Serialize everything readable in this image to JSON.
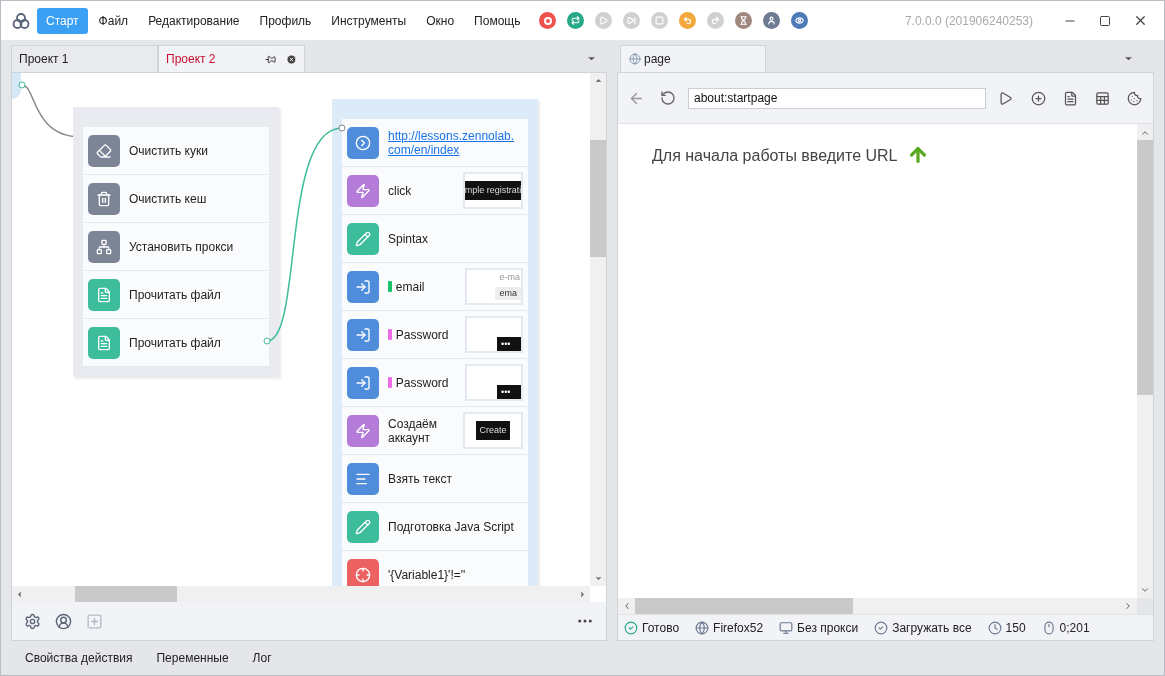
{
  "app": {
    "version": "7.0.0.0 (201906240253)"
  },
  "menu": [
    {
      "label": "Старт",
      "selected": true
    },
    {
      "label": "Файл",
      "selected": false
    },
    {
      "label": "Редактирование",
      "selected": false
    },
    {
      "label": "Профиль",
      "selected": false
    },
    {
      "label": "Инструменты",
      "selected": false
    },
    {
      "label": "Окно",
      "selected": false
    },
    {
      "label": "Помощь",
      "selected": false
    }
  ],
  "toolbar": [
    {
      "kind": "record",
      "disabled": false
    },
    {
      "kind": "loop",
      "disabled": false
    },
    {
      "kind": "play",
      "disabled": true
    },
    {
      "kind": "step",
      "disabled": true
    },
    {
      "kind": "stop",
      "disabled": true
    },
    {
      "kind": "undo",
      "disabled": false
    },
    {
      "kind": "redo",
      "disabled": true
    },
    {
      "kind": "hourglass",
      "disabled": false
    },
    {
      "kind": "user",
      "disabled": false
    },
    {
      "kind": "eye",
      "disabled": false
    }
  ],
  "project_tabs": [
    {
      "label": "Проект 1",
      "selected": false
    },
    {
      "label": "Проект 2",
      "selected": true
    }
  ],
  "canvas": {
    "groups": [
      {
        "items": [
          {
            "label": "Очистить куки",
            "kind": "cookies"
          },
          {
            "label": "Очистить кеш",
            "kind": "cache"
          },
          {
            "label": "Установить прокси",
            "kind": "proxy"
          },
          {
            "label": "Прочитать файл",
            "kind": "file"
          },
          {
            "label": "Прочитать файл",
            "kind": "file"
          }
        ]
      },
      {
        "items": [
          {
            "label": "http://lessons.zennolab.com/en/index",
            "kind": "navigate",
            "link": true
          },
          {
            "label": "click",
            "kind": "click",
            "thumbnail": {
              "kind": "button",
              "text": "mple registrati"
            }
          },
          {
            "label": "Spintax",
            "kind": "edit"
          },
          {
            "label": "email",
            "kind": "input",
            "color": "#19c26b",
            "thumbnail": {
              "kind": "field",
              "label": "e-ma",
              "value": "ema"
            }
          },
          {
            "label": "Password",
            "kind": "input",
            "color": "#ee6ae8",
            "thumbnail": {
              "kind": "password",
              "value": "•••"
            }
          },
          {
            "label": "Password",
            "kind": "input",
            "color": "#ee6ae8",
            "thumbnail": {
              "kind": "password",
              "value": "•••"
            }
          },
          {
            "label": "Создаём аккаунт",
            "kind": "click",
            "thumbnail": {
              "kind": "button",
              "text": "Create"
            }
          },
          {
            "label": "Взять текст",
            "kind": "text"
          },
          {
            "label": "Подготовка Java Script",
            "kind": "edit"
          },
          {
            "label": "'{Variable1}'!=''",
            "kind": "condition"
          }
        ]
      }
    ]
  },
  "browser": {
    "tab": "page",
    "url": "about:startpage",
    "message": "Для начала работы введите URL"
  },
  "status_bar": [
    {
      "kind": "ready",
      "text": "Готово"
    },
    {
      "kind": "browser",
      "text": "Firefox52"
    },
    {
      "kind": "proxy",
      "text": "Без прокси"
    },
    {
      "kind": "load",
      "text": "Загружать все"
    },
    {
      "kind": "timeout",
      "text": "150"
    },
    {
      "kind": "mouse",
      "text": "0;201"
    }
  ],
  "bottom_tabs": [
    {
      "label": "Свойства действия"
    },
    {
      "label": "Переменные"
    },
    {
      "label": "Лог"
    }
  ]
}
